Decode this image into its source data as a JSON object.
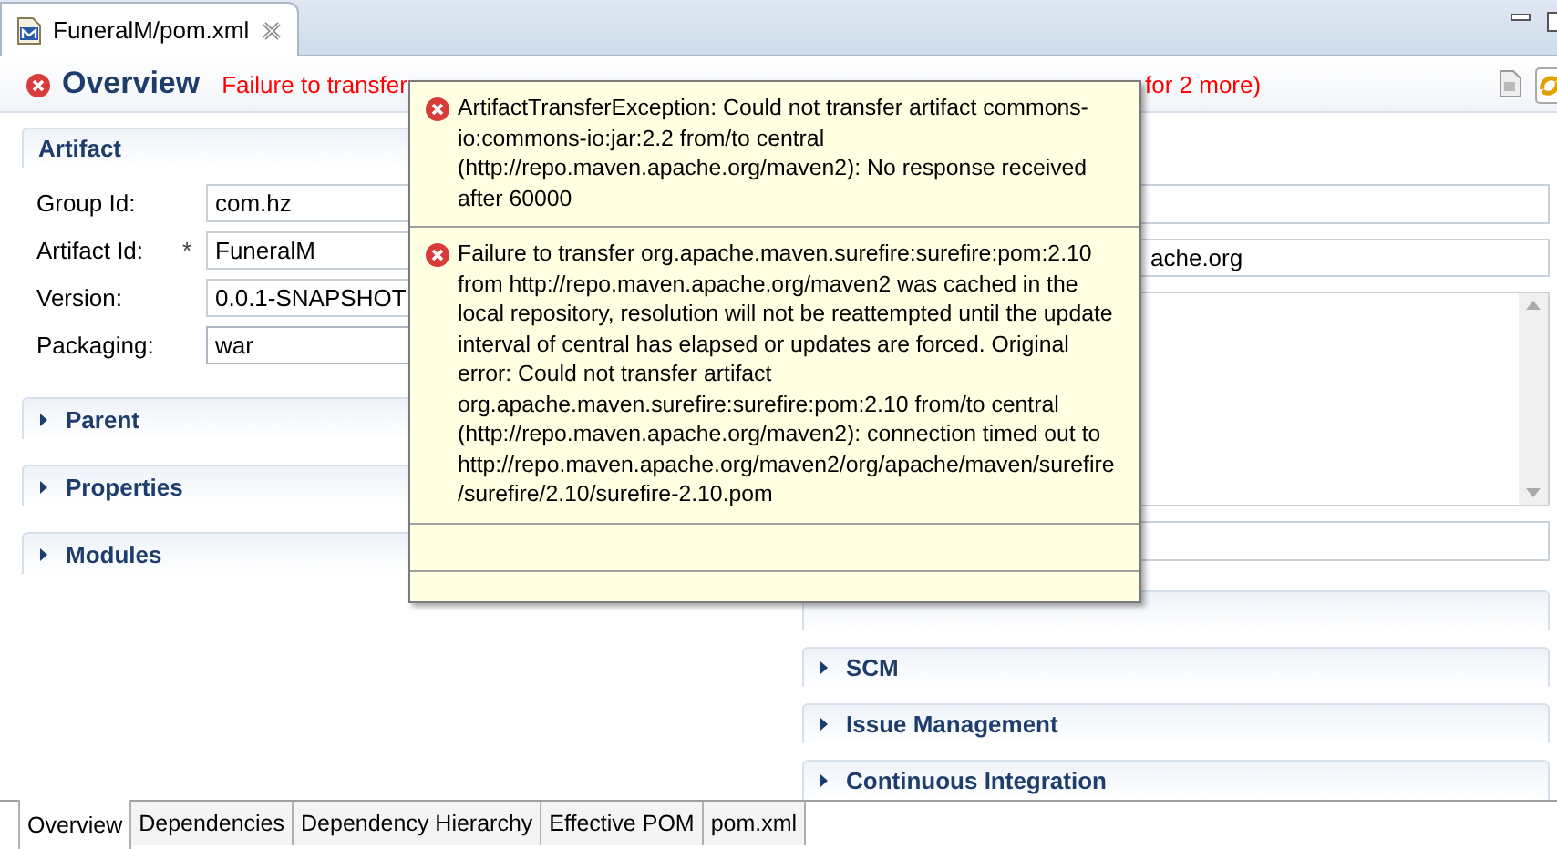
{
  "editor_tab": {
    "title": "FuneralM/pom.xml"
  },
  "header": {
    "title": "Overview",
    "error_start": "Failure to transfer",
    "error_end": "for 2 more)"
  },
  "artifact": {
    "title": "Artifact",
    "fields": [
      {
        "kind": "text",
        "label": "Group Id:",
        "value": "com.hz"
      },
      {
        "kind": "text",
        "label": "Artifact Id:",
        "mark": "*",
        "value": "FuneralM"
      },
      {
        "kind": "text",
        "label": "Version:",
        "value": "0.0.1-SNAPSHOT"
      },
      {
        "kind": "combo",
        "label": "Packaging:",
        "value": "war"
      }
    ]
  },
  "left_sections": [
    {
      "title": "Parent",
      "expanded": false
    },
    {
      "title": "Properties",
      "expanded": false
    },
    {
      "title": "Modules",
      "expanded": false
    }
  ],
  "right_fields": [
    {
      "kind": "text"
    },
    {
      "kind": "text",
      "value": "ache.org"
    },
    {
      "kind": "textarea"
    },
    {
      "kind": "text"
    }
  ],
  "right_sections": [
    {
      "title": "SCM",
      "expanded": false
    },
    {
      "title": "Issue Management",
      "expanded": false
    },
    {
      "title": "Continuous Integration",
      "expanded": false
    }
  ],
  "tooltip": {
    "messages": [
      "ArtifactTransferException: Could not transfer artifact commons-io:commons-io:jar:2.2 from/to central (http://repo.maven.apache.org/maven2): No response received after 60000",
      "Failure to transfer org.apache.maven.surefire:surefire:pom:2.10 from http://repo.maven.apache.org/maven2 was cached in the local repository, resolution will not be reattempted until the update interval of central has elapsed or updates are forced. Original error: Could not transfer artifact org.apache.maven.surefire:surefire:pom:2.10 from/to central (http://repo.maven.apache.org/maven2): connection timed out to http://repo.maven.apache.org/maven2/org/apache/maven/surefire/surefire/2.10/surefire-2.10.pom"
    ]
  },
  "page_tabs": [
    {
      "label": "Overview",
      "selected": true
    },
    {
      "label": "Dependencies",
      "selected": false
    },
    {
      "label": "Dependency Hierarchy",
      "selected": false
    },
    {
      "label": "Effective POM",
      "selected": false
    },
    {
      "label": "pom.xml",
      "selected": false
    }
  ]
}
